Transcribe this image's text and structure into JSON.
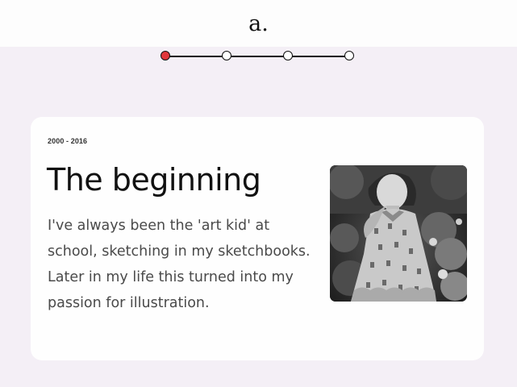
{
  "header": {
    "logo_text": "a."
  },
  "timeline": {
    "steps": [
      {
        "state": "active"
      },
      {
        "state": "inactive"
      },
      {
        "state": "inactive"
      },
      {
        "state": "inactive"
      }
    ],
    "active_color": "#e0363b"
  },
  "card": {
    "date_range": "2000 - 2016",
    "title": "The beginning",
    "body": "I've always been the 'art kid' at school, sketching in my sketchbooks. Later in my life this turned into my passion for illustration."
  }
}
